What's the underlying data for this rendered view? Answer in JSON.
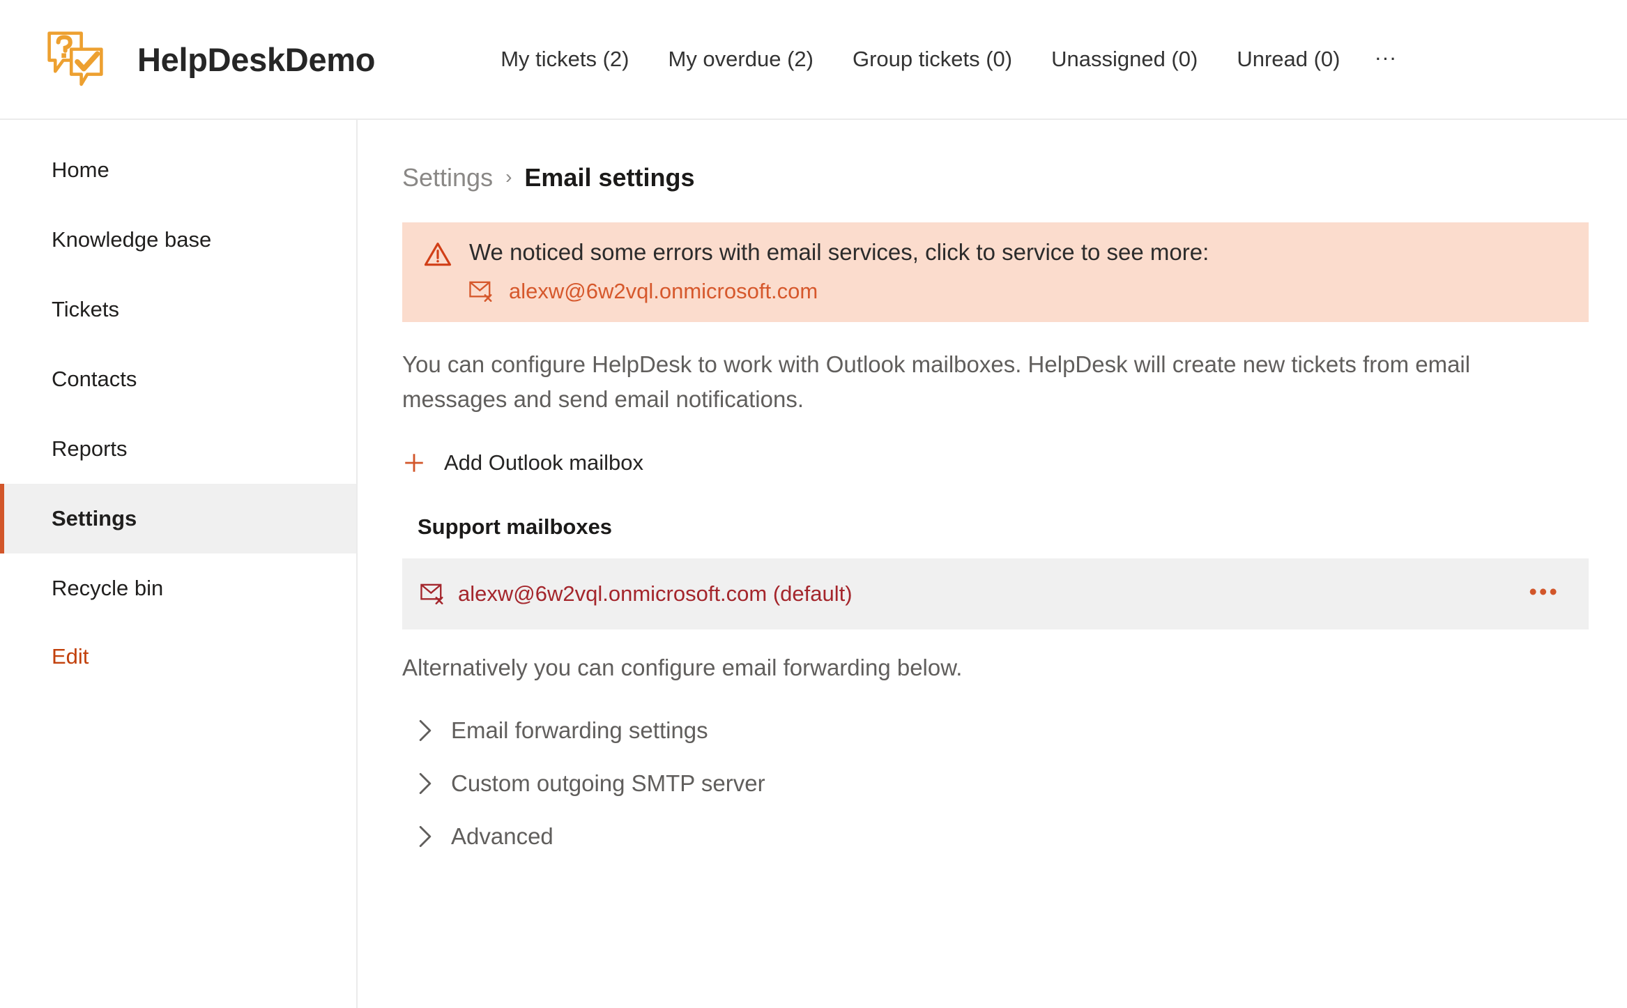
{
  "header": {
    "app_title": "HelpDeskDemo",
    "logo_icon": "helpdesk-speech-bubbles-icon",
    "nav_items": [
      {
        "label": "My tickets (2)"
      },
      {
        "label": "My overdue (2)"
      },
      {
        "label": "Group tickets (0)"
      },
      {
        "label": "Unassigned (0)"
      },
      {
        "label": "Unread (0)"
      }
    ],
    "more_label": "..."
  },
  "sidebar": {
    "items": [
      {
        "label": "Home",
        "active": false
      },
      {
        "label": "Knowledge base",
        "active": false
      },
      {
        "label": "Tickets",
        "active": false
      },
      {
        "label": "Contacts",
        "active": false
      },
      {
        "label": "Reports",
        "active": false
      },
      {
        "label": "Settings",
        "active": true
      },
      {
        "label": "Recycle bin",
        "active": false
      }
    ],
    "edit_label": "Edit"
  },
  "breadcrumb": {
    "parent": "Settings",
    "separator": "›",
    "current": "Email settings"
  },
  "error_banner": {
    "icon": "warning-triangle-icon",
    "message": "We noticed some errors with email services, click to service to see more:",
    "link_icon": "mail-error-icon",
    "link_label": "alexw@6w2vql.onmicrosoft.com"
  },
  "description": "You can configure HelpDesk to work with Outlook mailboxes. HelpDesk will create new tickets from email messages and send email notifications.",
  "add_mailbox": {
    "icon": "plus-icon",
    "label": "Add Outlook mailbox"
  },
  "support_mailboxes": {
    "title": "Support mailboxes",
    "rows": [
      {
        "icon": "mail-error-icon",
        "address": "alexw@6w2vql.onmicrosoft.com (default)",
        "menu_label": "•••"
      }
    ]
  },
  "alternative_text": "Alternatively you can configure email forwarding below.",
  "accordions": [
    {
      "label": "Email forwarding settings",
      "icon": "chevron-right-icon"
    },
    {
      "label": "Custom outgoing SMTP server",
      "icon": "chevron-right-icon"
    },
    {
      "label": "Advanced",
      "icon": "chevron-right-icon"
    }
  ],
  "colors": {
    "accent_orange": "#d2562a",
    "banner_bg": "#fbdccd",
    "banner_icon": "#d13f17",
    "banner_link": "#d6582c",
    "mailbox_red": "#a4262c",
    "row_bg": "#f0f0f0",
    "logo_orange": "#eda030",
    "muted_text": "#605e5c"
  }
}
